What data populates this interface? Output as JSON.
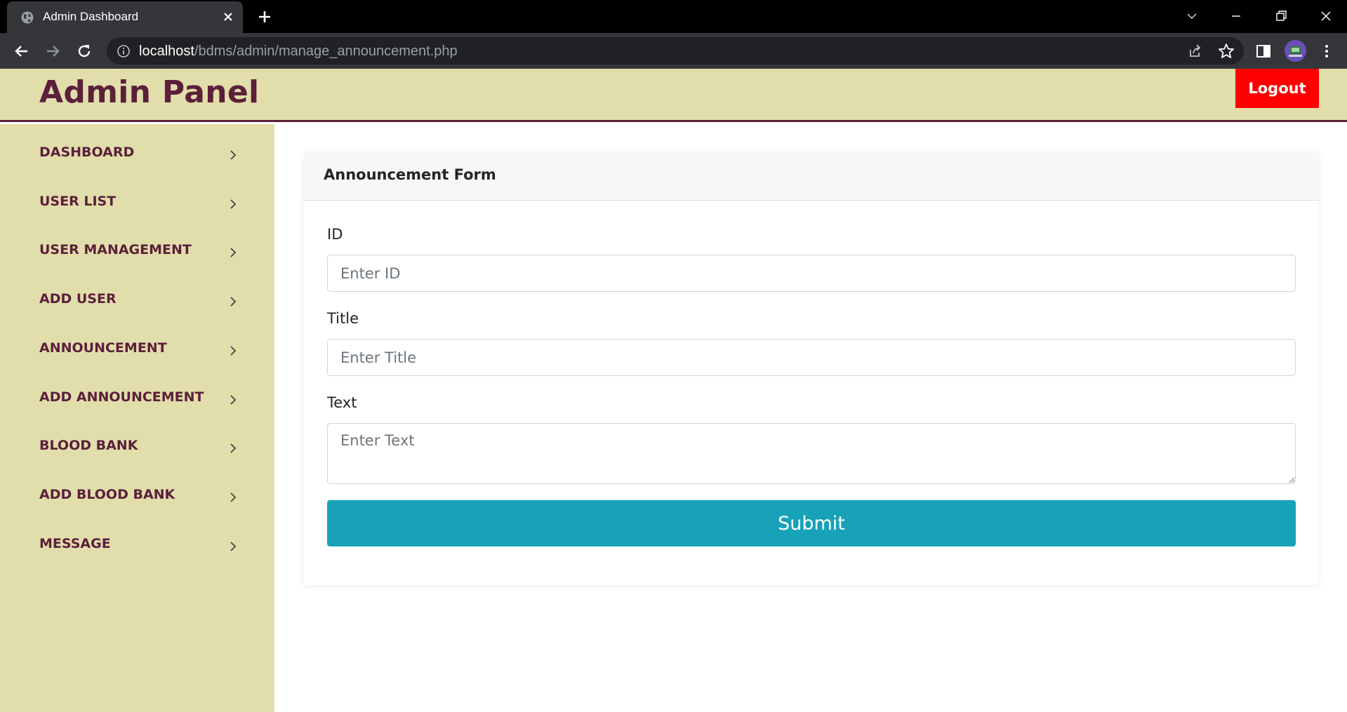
{
  "browser": {
    "tab_title": "Admin Dashboard",
    "url_host": "localhost",
    "url_path": "/bdms/admin/manage_announcement.php"
  },
  "header": {
    "brand": "Admin Panel",
    "logout_label": "Logout"
  },
  "sidebar": {
    "items": [
      {
        "label": "DASHBOARD"
      },
      {
        "label": "USER LIST"
      },
      {
        "label": "USER MANAGEMENT"
      },
      {
        "label": "ADD USER"
      },
      {
        "label": "ANNOUNCEMENT"
      },
      {
        "label": "ADD ANNOUNCEMENT"
      },
      {
        "label": "BLOOD BANK"
      },
      {
        "label": "ADD BLOOD BANK"
      },
      {
        "label": "MESSAGE"
      }
    ]
  },
  "form": {
    "title": "Announcement Form",
    "id_label": "ID",
    "id_placeholder": "Enter ID",
    "title_label": "Title",
    "title_placeholder": "Enter Title",
    "text_label": "Text",
    "text_placeholder": "Enter Text",
    "submit_label": "Submit"
  },
  "colors": {
    "header_bg": "#e1deac",
    "brand_text": "#5c1f3a",
    "logout_bg": "#ff0000",
    "submit_bg": "#17a2b8"
  },
  "icons": [
    "globe-icon",
    "close-icon",
    "plus-icon",
    "chevron-down-icon",
    "minimize-icon",
    "restore-icon",
    "back-icon",
    "forward-icon",
    "reload-icon",
    "info-icon",
    "share-icon",
    "star-icon",
    "side-panel-icon",
    "kebab-menu-icon",
    "chevron-right-icon"
  ]
}
